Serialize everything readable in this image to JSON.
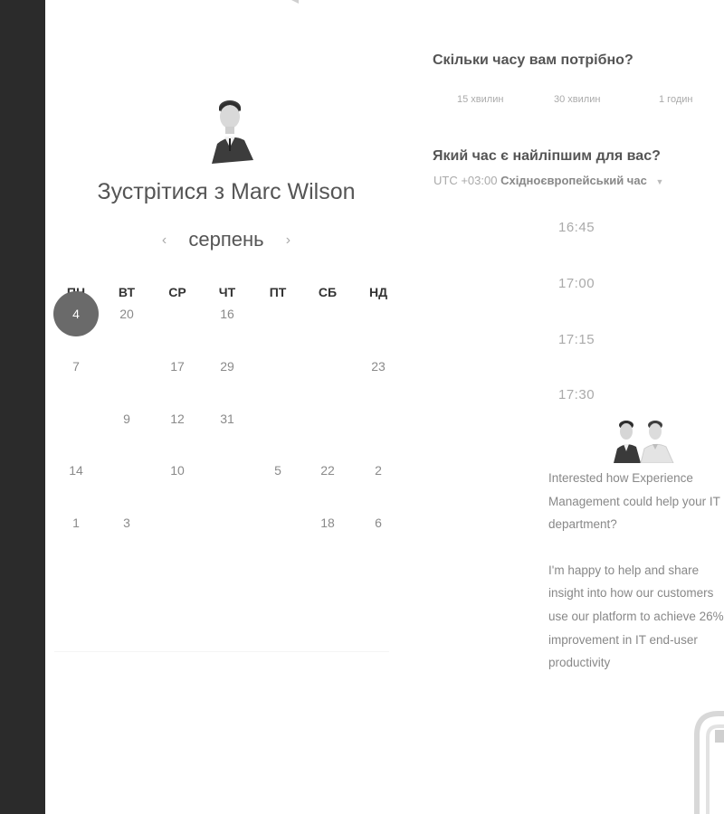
{
  "meeting": {
    "title_prefix": "Зустрітися з ",
    "host_name": "Marc Wilson"
  },
  "calendar": {
    "month": "серпень",
    "prev_icon": "chevron-left-icon",
    "next_icon": "chevron-right-icon",
    "weekdays": [
      "ПН",
      "ВТ",
      "СР",
      "ЧТ",
      "ПТ",
      "СБ",
      "НД"
    ],
    "today": "4",
    "rows": [
      [
        "4",
        "20",
        "",
        "16",
        "",
        "",
        ""
      ],
      [
        "7",
        "",
        "17",
        "29",
        "",
        "",
        "23"
      ],
      [
        "",
        "9",
        "12",
        "31",
        "",
        "",
        ""
      ],
      [
        "14",
        "",
        "10",
        "",
        "5",
        "22",
        "2"
      ],
      [
        "1",
        "3",
        "",
        "",
        "",
        "18",
        "6"
      ]
    ]
  },
  "duration": {
    "question": "Скільки часу вам потрібно?",
    "options": [
      "15 хвилин",
      "30 хвилин",
      "1 годин"
    ]
  },
  "time": {
    "question": "Який час є найліпшим для вас?",
    "tz_offset": "UTC +03:00",
    "tz_name": "Східноєвропейський час",
    "slots": [
      "16:45",
      "17:00",
      "17:15",
      "17:30"
    ]
  },
  "pitch": {
    "paragraph1": "Interested how Experience Management could help your IT department?",
    "paragraph2": "I'm happy to help and share insight into how our customers use our platform to achieve 26% improvement in IT end-user productivity"
  },
  "colors": {
    "left_bar": "#2b2b2b",
    "today_circle": "#6a6a6a",
    "text_muted": "#aaaaaa"
  }
}
